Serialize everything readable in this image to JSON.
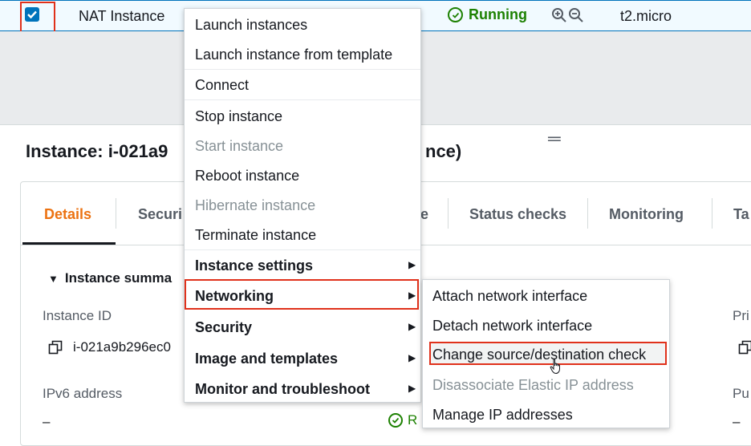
{
  "row": {
    "name": "NAT Instance",
    "state": "Running",
    "type": "t2.micro"
  },
  "instance_title": "Instance: i-021a9",
  "instance_title_tail": "nce)",
  "tabs": [
    {
      "label": "Details"
    },
    {
      "label": "Securi"
    },
    {
      "label": "e"
    },
    {
      "label": "Status checks"
    },
    {
      "label": "Monitoring"
    },
    {
      "label": "Ta"
    }
  ],
  "summary": {
    "header": "Instance summa",
    "instance_id_label": "Instance ID",
    "instance_id_value": "i-021a9b296ec0",
    "ipv6_label": "IPv6 address",
    "ipv6_value": "–",
    "state_value": "R",
    "right_label_1": "Pri",
    "right_label_2": "Pu",
    "right_value_2": "–"
  },
  "menu": {
    "items": [
      {
        "label": "Launch instances"
      },
      {
        "label": "Launch instance from template"
      },
      {
        "label": "Connect"
      },
      {
        "label": "Stop instance"
      },
      {
        "label": "Start instance"
      },
      {
        "label": "Reboot instance"
      },
      {
        "label": "Hibernate instance"
      },
      {
        "label": "Terminate instance"
      },
      {
        "label": "Instance settings"
      },
      {
        "label": "Networking"
      },
      {
        "label": "Security"
      },
      {
        "label": "Image and templates"
      },
      {
        "label": "Monitor and troubleshoot"
      }
    ]
  },
  "submenu": {
    "items": [
      {
        "label": "Attach network interface"
      },
      {
        "label": "Detach network interface"
      },
      {
        "label": "Change source/destination check"
      },
      {
        "label": "Disassociate Elastic IP address"
      },
      {
        "label": "Manage IP addresses"
      }
    ]
  },
  "colors": {
    "accent": "#0073bb",
    "running": "#1d8102",
    "active_tab": "#ec7211",
    "highlight": "#e0311b"
  }
}
